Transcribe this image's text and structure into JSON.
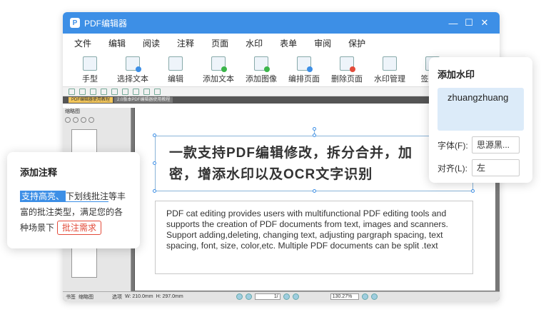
{
  "window": {
    "title": "PDF编辑器",
    "logo_letter": "P",
    "controls": {
      "minimize": "—",
      "maximize": "☐",
      "close": "✕"
    }
  },
  "menu": [
    "文件",
    "编辑",
    "阅读",
    "注释",
    "页面",
    "水印",
    "表单",
    "审阅",
    "保护"
  ],
  "toolbar": [
    {
      "label": "手型",
      "icon": "hand-icon"
    },
    {
      "label": "选择文本",
      "icon": "select-text-icon"
    },
    {
      "label": "编辑",
      "icon": "edit-icon"
    },
    {
      "label": "添加文本",
      "icon": "add-text-icon"
    },
    {
      "label": "添加图像",
      "icon": "add-image-icon"
    },
    {
      "label": "编排页面",
      "icon": "arrange-pages-icon"
    },
    {
      "label": "删除页面",
      "icon": "delete-page-icon"
    },
    {
      "label": "水印管理",
      "icon": "watermark-icon"
    },
    {
      "label": "签名文",
      "icon": "signature-icon"
    }
  ],
  "doc_tabs": [
    "PDF编辑器使用教程",
    "2.0版本PDF编辑器使用教程"
  ],
  "left_panel": {
    "title": "缩略图",
    "bottom_tabs": [
      "书签",
      "缩略图"
    ]
  },
  "status": {
    "page": "1/",
    "zoom": "130.27%",
    "coords_w": "W: 210.0mm",
    "coords_h": "H: 297.0mm",
    "select_tool": "选项"
  },
  "page": {
    "headline": "一款支持PDF编辑修改，拆分合并，加密，增添水印以及OCR文字识别",
    "body": "PDF cat editing provides users with multifunctional PDF editing tools and supports the creation of PDF documents from text, images and scanners. Support adding,deleting, changing text, adjusting pargraph spacing, text spacing, font, size, color,etc. Multiple PDF documents can be split .text"
  },
  "annot_card": {
    "title": "添加注释",
    "highlight": "支持高亮、",
    "underline": "下划线批注",
    "rest": "等丰富的批注类型，满足您的各种场景下",
    "button": "批注需求"
  },
  "watermark_card": {
    "title": "添加水印",
    "text_value": "zhuangzhuang",
    "font_label": "字体(F):",
    "font_value": "思源黑...",
    "align_label": "对齐(L):",
    "align_value": "左"
  },
  "colors": {
    "accent": "#3d8fe6",
    "red": "#e34b3a",
    "watermark_bg": "#dcebf9"
  }
}
